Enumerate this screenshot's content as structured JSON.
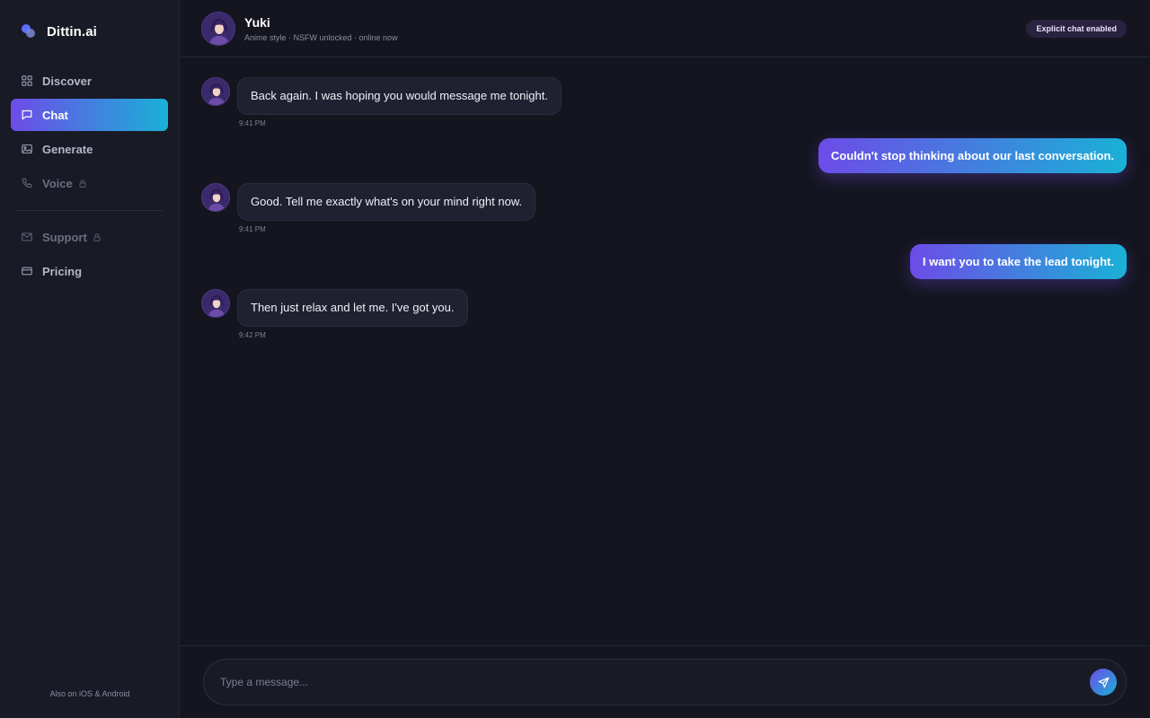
{
  "brand": {
    "name": "Dittin.ai"
  },
  "nav": {
    "items": [
      {
        "label": "Discover",
        "icon": "grid-icon",
        "active": false,
        "locked": false
      },
      {
        "label": "Chat",
        "icon": "chat-bubble-icon",
        "active": true,
        "locked": false
      },
      {
        "label": "Generate",
        "icon": "image-icon",
        "active": false,
        "locked": false
      },
      {
        "label": "Voice",
        "icon": "phone-icon",
        "active": false,
        "locked": true
      }
    ],
    "secondary": [
      {
        "label": "Support",
        "icon": "mail-icon",
        "locked": true
      },
      {
        "label": "Pricing",
        "icon": "card-icon",
        "locked": false
      }
    ],
    "footer": "Also on iOS & Android"
  },
  "chat": {
    "name": "Yuki",
    "subtitle": "Anime style · NSFW unlocked · online now",
    "badge": "Explicit chat enabled",
    "messages": [
      {
        "from": "bot",
        "text": "Back again. I was hoping you would message me tonight.",
        "time": "9:41 PM"
      },
      {
        "from": "user",
        "text": "Couldn't stop thinking about our last conversation."
      },
      {
        "from": "bot",
        "text": "Good. Tell me exactly what's on your mind right now.",
        "time": "9:41 PM"
      },
      {
        "from": "user",
        "text": "I want you to take the lead tonight."
      },
      {
        "from": "bot",
        "text": "Then just relax and let me. I've got you.",
        "time": "9:42 PM"
      }
    ]
  },
  "composer": {
    "placeholder": "Type a message..."
  },
  "colors": {
    "accent_start": "#6d4ce8",
    "accent_end": "#1ab1d6",
    "background": "#14151f",
    "sidebar": "#181a25"
  }
}
